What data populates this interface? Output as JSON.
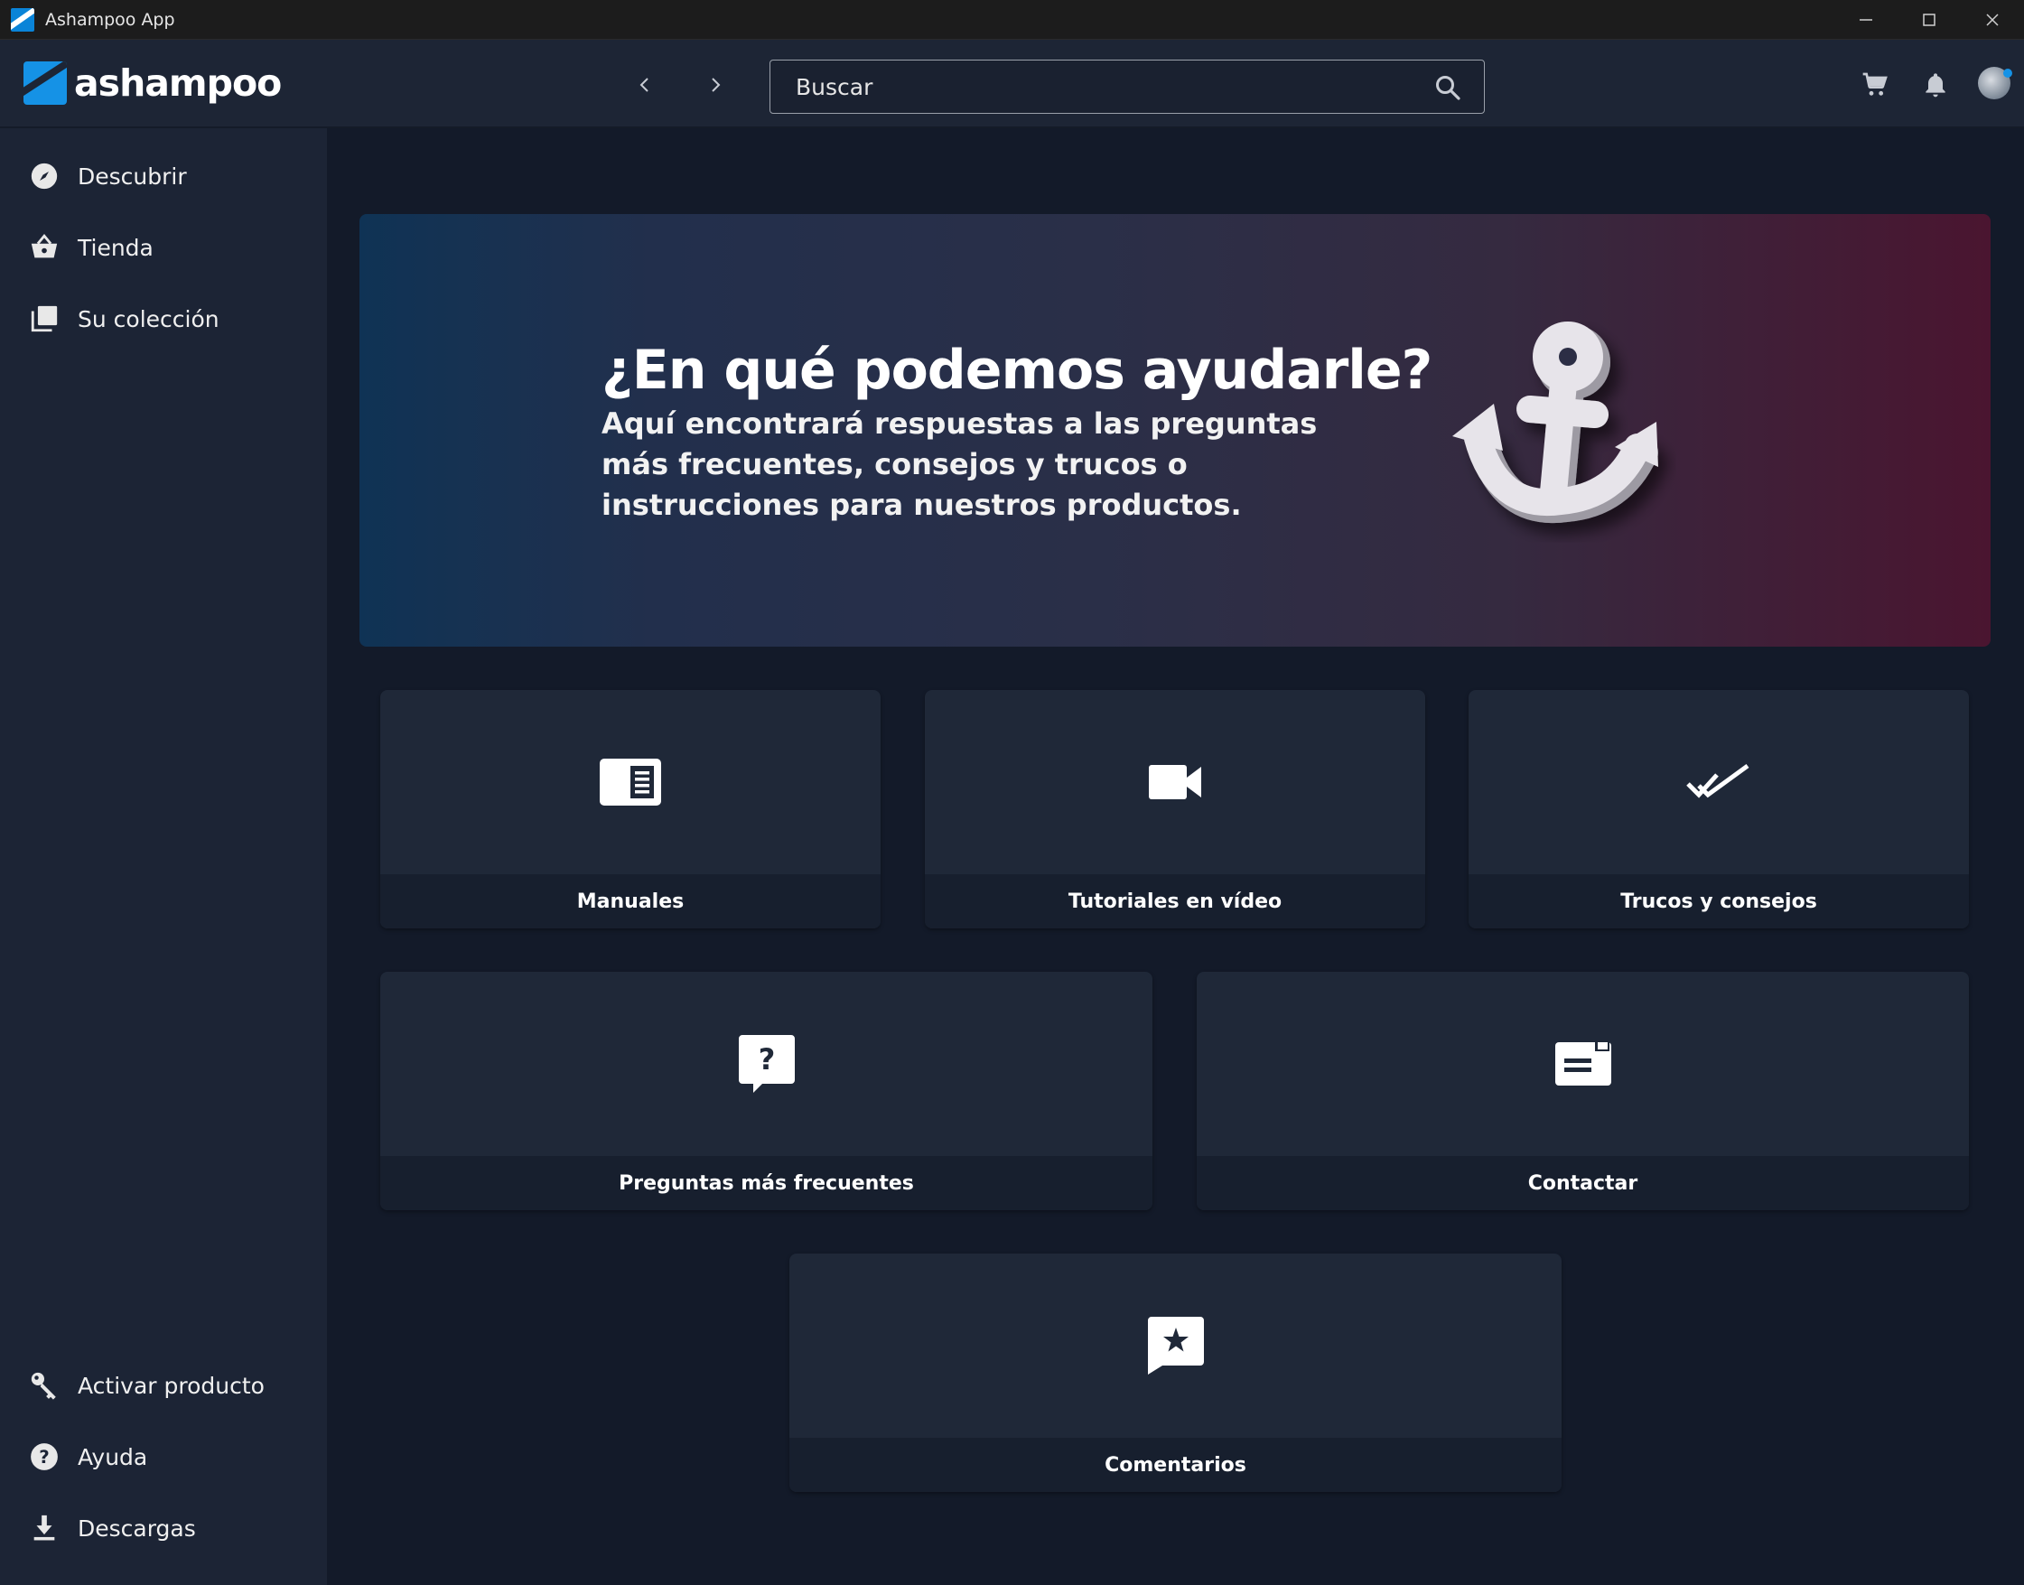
{
  "window": {
    "title": "Ashampoo App",
    "controls": {
      "minimize": "—",
      "maximize": "☐",
      "close": "✕"
    }
  },
  "header": {
    "logo_text": "ashampoo",
    "search": {
      "placeholder": "Buscar",
      "value": ""
    }
  },
  "sidebar": {
    "top_items": [
      {
        "label": "Descubrir",
        "icon": "compass-icon"
      },
      {
        "label": "Tienda",
        "icon": "basket-icon"
      },
      {
        "label": "Su colección",
        "icon": "collection-icon"
      }
    ],
    "bottom_items": [
      {
        "label": "Activar producto",
        "icon": "key-icon"
      },
      {
        "label": "Ayuda",
        "icon": "help-icon"
      },
      {
        "label": "Descargas",
        "icon": "download-icon"
      }
    ]
  },
  "hero": {
    "title": "¿En qué podemos ayudarle?",
    "subtitle": "Aquí encontrará respuestas a las preguntas más frecuentes, consejos y trucos o instrucciones para nuestros productos."
  },
  "cards": [
    {
      "label": "Manuales",
      "icon": "manual-icon"
    },
    {
      "label": "Tutoriales en vídeo",
      "icon": "video-camera-icon"
    },
    {
      "label": "Trucos y consejos",
      "icon": "double-check-icon"
    },
    {
      "label": "Preguntas más frecuentes",
      "icon": "question-chat-icon"
    },
    {
      "label": "Contactar",
      "icon": "contact-card-icon"
    },
    {
      "label": "Comentarios",
      "icon": "star-chat-icon"
    }
  ],
  "colors": {
    "background": "#131a29",
    "sidebar": "#1c2435",
    "card": "#1f2838",
    "accent": "#1592e6"
  }
}
